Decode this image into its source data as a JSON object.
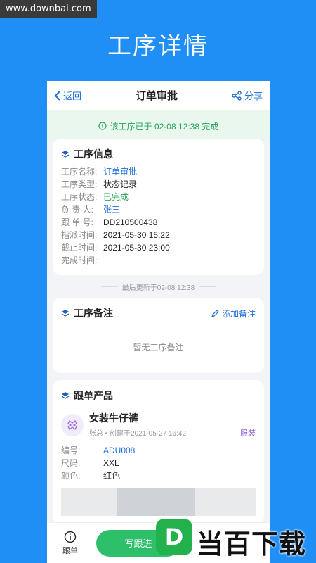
{
  "watermark": "www.downbai.com",
  "promo_title": "工序详情",
  "topbar": {
    "back_label": "返回",
    "title": "订单审批",
    "share_label": "分享"
  },
  "status_banner": "该工序已于 02-08 12:38 完成",
  "process_info": {
    "title": "工序信息",
    "rows": [
      {
        "label": "工序名称:",
        "value": "订单审批"
      },
      {
        "label": "工序类型:",
        "value": "状态记录"
      },
      {
        "label": "工序状态:",
        "value": "已完成"
      },
      {
        "label": "负 责 人:",
        "value": "张三"
      },
      {
        "label": "跟 单 号:",
        "value": "DD210500438"
      },
      {
        "label": "指派时间:",
        "value": "2021-05-30 15:22"
      },
      {
        "label": "截止时间:",
        "value": "2021-05-30 23:00"
      },
      {
        "label": "完成时间:",
        "value": ""
      }
    ]
  },
  "last_updated": "最后更新于02-08 12:38",
  "notes": {
    "title": "工序备注",
    "add_label": "添加备注",
    "empty_text": "暂无工序备注"
  },
  "product": {
    "section_title": "跟单产品",
    "name": "女装牛仔裤",
    "creator": "张总 • 创建于2021-05-27 16:42",
    "tag": "服装",
    "rows": [
      {
        "label": "编号:",
        "value": "ADU008"
      },
      {
        "label": "尺码:",
        "value": "XXL"
      },
      {
        "label": "颜色:",
        "value": "红色"
      }
    ]
  },
  "bottom": {
    "tab_label": "跟单",
    "cta_label": "写跟进"
  },
  "brand_overlay": {
    "mark": "D",
    "text": "当百下载"
  },
  "colors": {
    "primary_bg": "#1f8ef5",
    "link": "#1e6fd9",
    "success": "#27a35a",
    "tag": "#8a63d2"
  }
}
